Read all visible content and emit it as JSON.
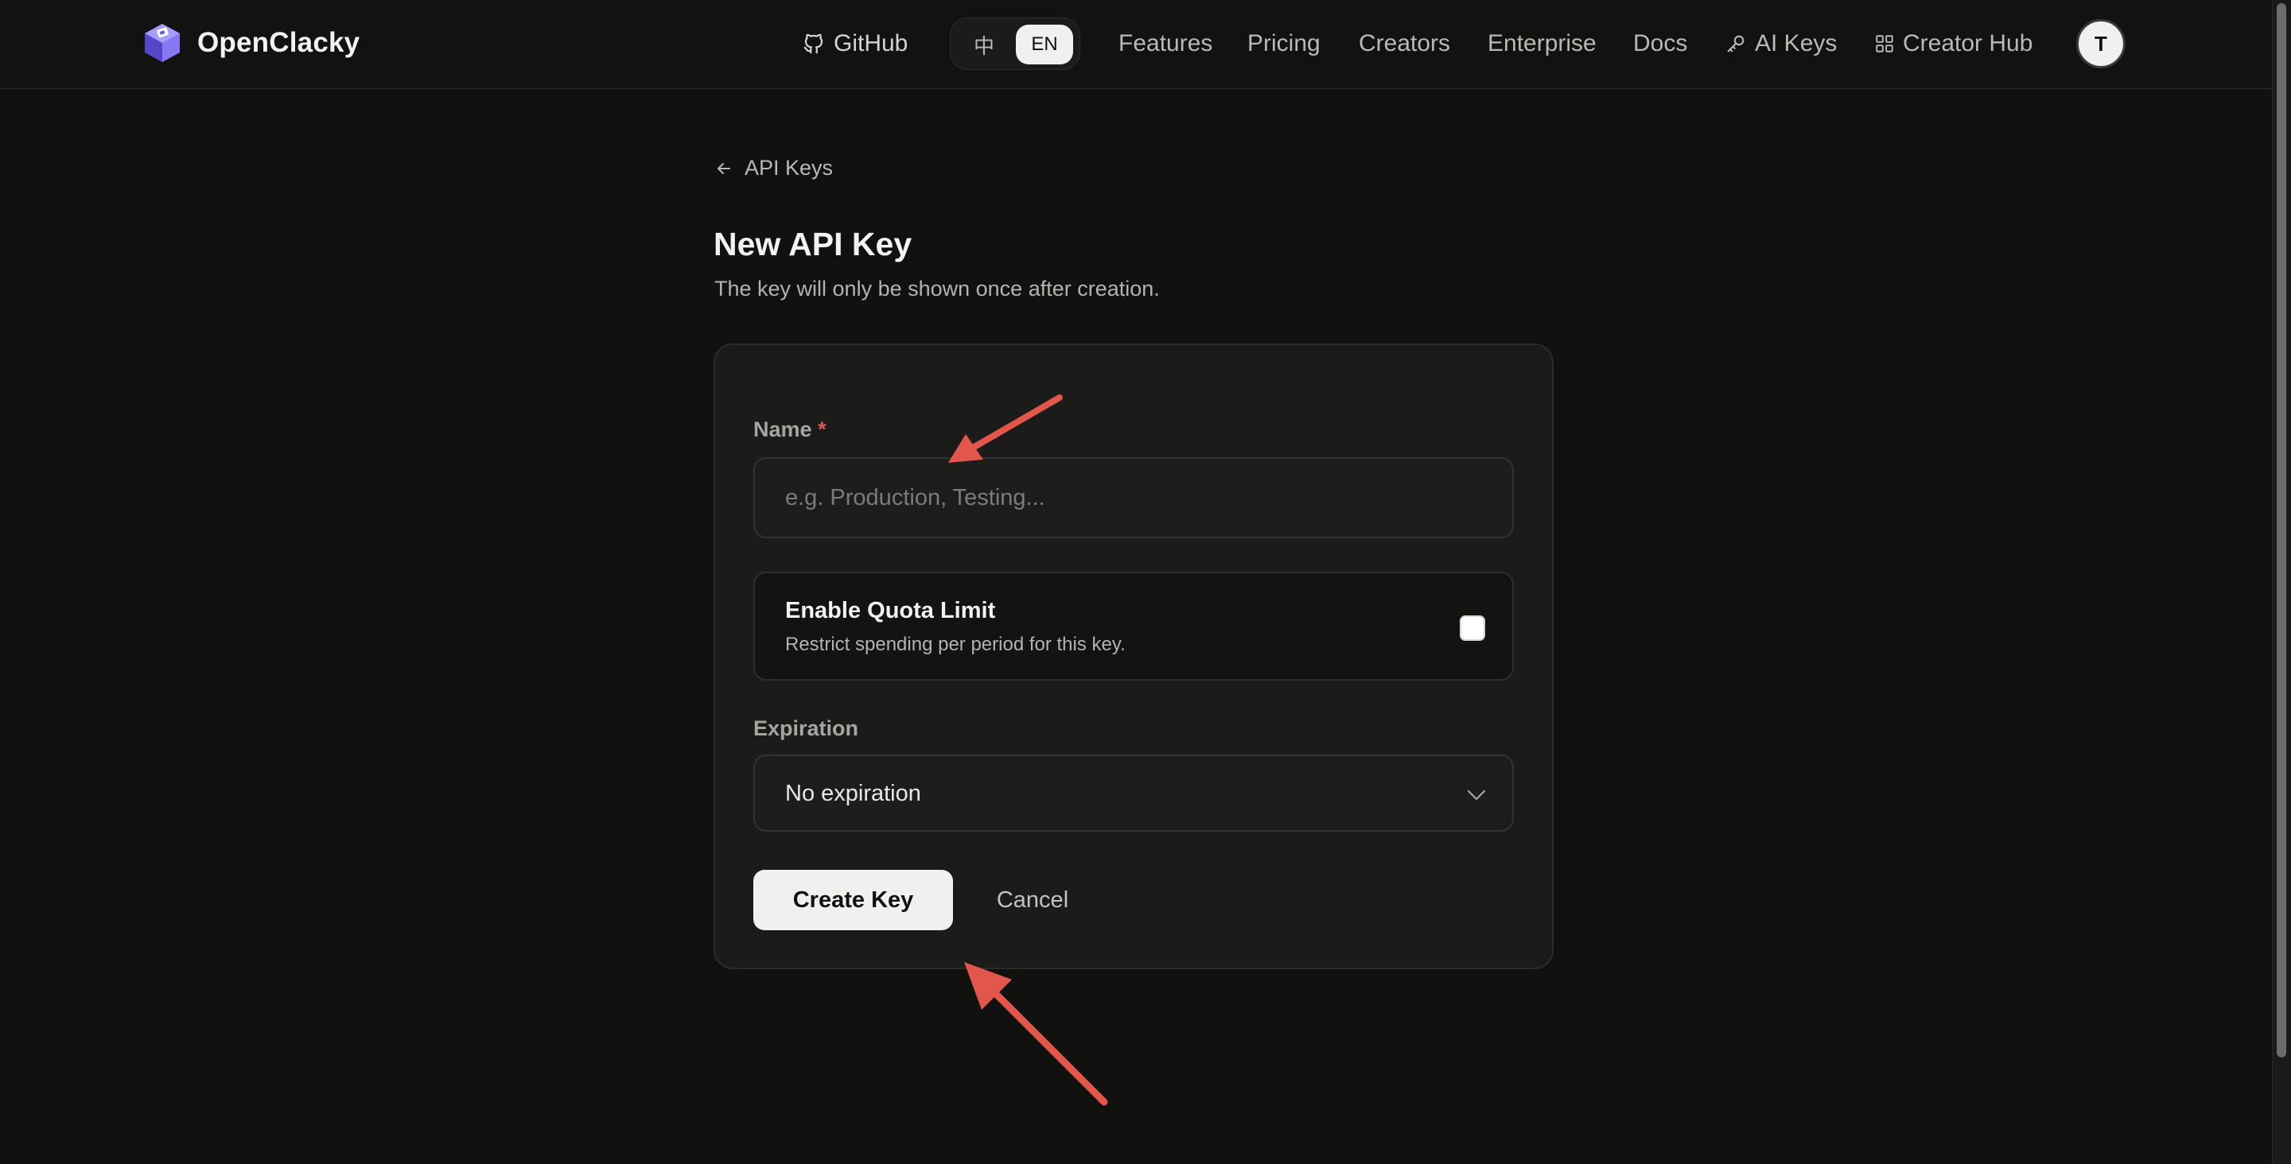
{
  "header": {
    "brand": "OpenClacky",
    "nav": {
      "github": "GitHub",
      "lang_zh": "中",
      "lang_en": "EN",
      "features": "Features",
      "pricing": "Pricing",
      "creators": "Creators",
      "enterprise": "Enterprise",
      "docs": "Docs",
      "ai_keys": "AI Keys",
      "creator_hub": "Creator Hub"
    },
    "avatar_initial": "T"
  },
  "breadcrumb": {
    "back_label": "API Keys"
  },
  "page": {
    "title": "New API Key",
    "subtitle": "The key will only be shown once after creation."
  },
  "form": {
    "name_label": "Name",
    "required_mark": "*",
    "name_placeholder": "e.g. Production, Testing...",
    "name_value": "",
    "quota": {
      "title": "Enable Quota Limit",
      "description": "Restrict spending per period for this key.",
      "checked": false
    },
    "expiration_label": "Expiration",
    "expiration_value": "No expiration",
    "create_label": "Create Key",
    "cancel_label": "Cancel"
  },
  "colors": {
    "background": "#111110",
    "card": "#1b1b1a",
    "accent_light": "#f0f0ee",
    "required": "#e0584f",
    "annotation_arrow": "#e2564c",
    "logo": "#7b6cf0"
  },
  "icons": {
    "logo": "cube-logo-icon",
    "github": "github-icon",
    "ai_keys": "key-icon",
    "creator_hub": "grid-icon",
    "back": "arrow-left-icon",
    "select": "chevron-down-icon"
  }
}
